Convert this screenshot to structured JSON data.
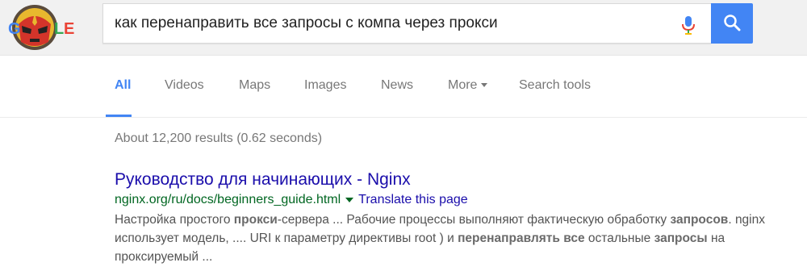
{
  "search": {
    "query": "как перенаправить все запросы с компа через прокси"
  },
  "nav": {
    "tabs": [
      {
        "label": "All",
        "active": true
      },
      {
        "label": "Videos"
      },
      {
        "label": "Maps"
      },
      {
        "label": "Images"
      },
      {
        "label": "News"
      },
      {
        "label": "More"
      },
      {
        "label": "Search tools"
      }
    ]
  },
  "stats": "About 12,200 results (0.62 seconds)",
  "results": [
    {
      "title": "Руководство для начинающих - Nginx",
      "url": "nginx.org/ru/docs/beginners_guide.html",
      "translate": "Translate this page",
      "snippet": [
        {
          "t": "Настройка простого ",
          "b": false
        },
        {
          "t": "прокси",
          "b": true
        },
        {
          "t": "-сервера ... Рабочие процессы выполняют фактическую обработку ",
          "b": false
        },
        {
          "t": "запросов",
          "b": true
        },
        {
          "t": ". nginx использует модель, .... URI к параметру директивы root ) и ",
          "b": false
        },
        {
          "t": "перенаправлять все",
          "b": true
        },
        {
          "t": " остальные ",
          "b": false
        },
        {
          "t": "запросы",
          "b": true
        },
        {
          "t": " на проксируемый ...",
          "b": false
        }
      ]
    }
  ],
  "colors": {
    "accent": "#4285f4",
    "link": "#1a0dab",
    "url_green": "#006621"
  }
}
